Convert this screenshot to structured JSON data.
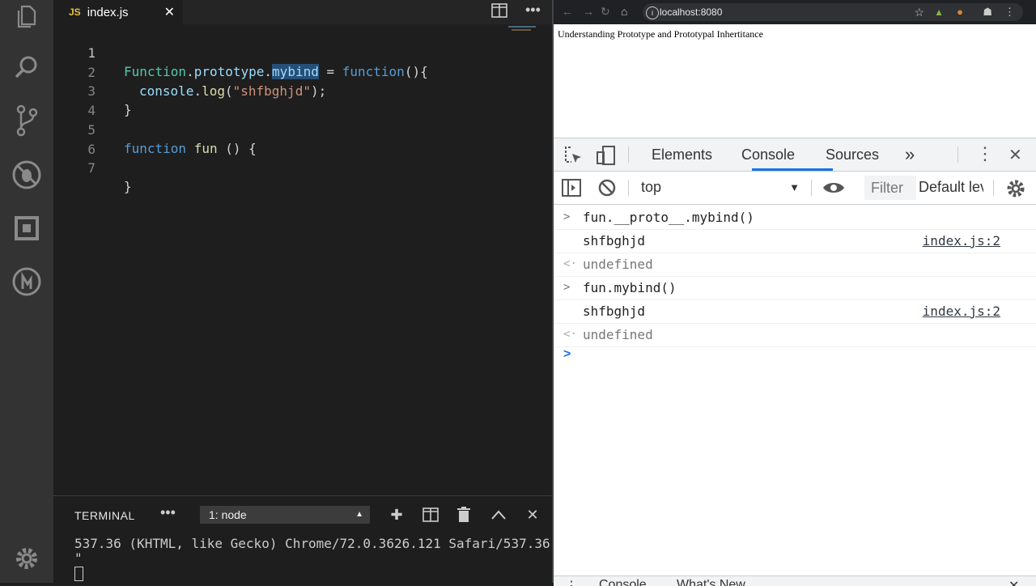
{
  "editor": {
    "tab": {
      "icon_text": "JS",
      "filename": "index.js",
      "close": "✕"
    },
    "lines": [
      {
        "n": "1"
      },
      {
        "n": "2"
      },
      {
        "n": "3"
      },
      {
        "n": "4"
      },
      {
        "n": "5"
      },
      {
        "n": "6"
      },
      {
        "n": "7"
      }
    ],
    "code": {
      "l1": {
        "a": "Function",
        "b": ".",
        "c": "prototype",
        "d": ".",
        "e": "mybind",
        "f": " = ",
        "g": "function",
        "h": "(){"
      },
      "l2": {
        "a": "console",
        "b": ".",
        "c": "log",
        "d": "(",
        "e": "\"shfbghjd\"",
        "f": ");"
      },
      "l3": {
        "a": "}"
      },
      "l5": {
        "a": "function",
        "b": " ",
        "c": "fun",
        "d": " () {"
      },
      "l7": {
        "a": "}"
      }
    }
  },
  "terminal": {
    "title": "TERMINAL",
    "more": "•••",
    "selected_shell": "1: node",
    "output_line1": "537.36 (KHTML, like Gecko) Chrome/72.0.3626.121 Safari/537.36",
    "output_line2": "\""
  },
  "browser": {
    "url": "localhost:8080",
    "page_heading": "Understanding Prototype and Prototypal Inhertitance"
  },
  "devtools": {
    "tabs": [
      "Elements",
      "Console",
      "Sources"
    ],
    "more_tabs": "»",
    "context": "top",
    "filter_placeholder": "Filter",
    "levels": "Default levels",
    "console": [
      {
        "kind": "cmd",
        "text": "fun.__proto__.mybind()"
      },
      {
        "kind": "log",
        "text": "shfbghjd",
        "source": "index.js:2"
      },
      {
        "kind": "result",
        "text": "undefined"
      },
      {
        "kind": "cmd",
        "text": "fun.mybind()"
      },
      {
        "kind": "log",
        "text": "shfbghjd",
        "source": "index.js:2"
      },
      {
        "kind": "result",
        "text": "undefined"
      }
    ],
    "drawer_tabs": [
      "Console",
      "What's New"
    ]
  },
  "colors": {
    "accent": "#1a73e8",
    "activity_bar": "#333333",
    "editor_bg": "#1e1e1e"
  }
}
